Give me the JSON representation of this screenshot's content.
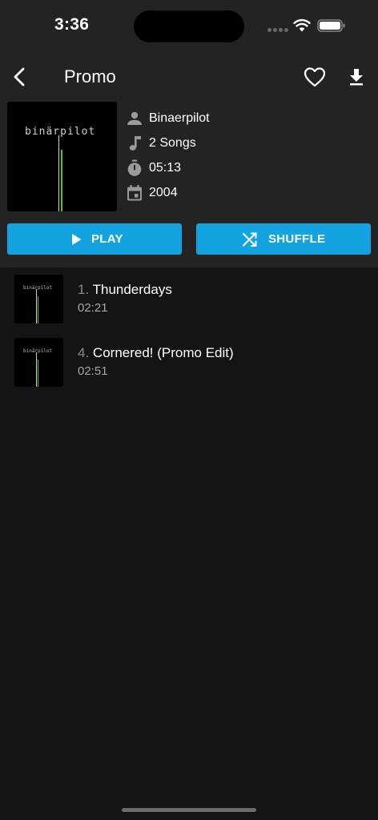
{
  "status_bar": {
    "time": "3:36"
  },
  "nav": {
    "title": "Promo",
    "back_icon": "chevron-left-icon",
    "favorite_icon": "heart-outline-icon",
    "download_icon": "download-icon"
  },
  "album": {
    "cover_logo_text": "binärpilot",
    "artist": "Binaerpilot",
    "song_count": "2 Songs",
    "duration": "05:13",
    "year": "2004"
  },
  "actions": {
    "play_label": "PLAY",
    "shuffle_label": "SHUFFLE",
    "accent_color": "#12a3e0"
  },
  "tracks": [
    {
      "number": "1.",
      "title": "Thunderdays",
      "duration": "02:21",
      "thumb_logo_text": "binärpilot"
    },
    {
      "number": "4.",
      "title": "Cornered! (Promo Edit)",
      "duration": "02:51",
      "thumb_logo_text": "binärpilot"
    }
  ]
}
